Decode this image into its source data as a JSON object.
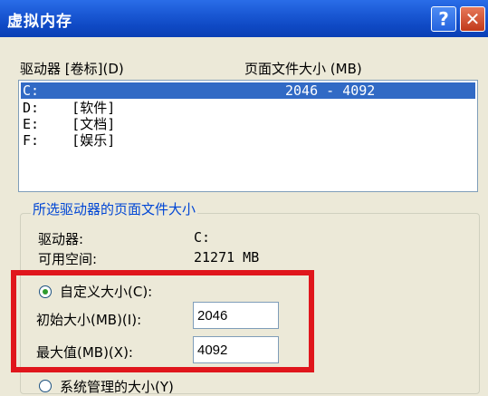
{
  "window": {
    "title": "虚拟内存",
    "help": "?",
    "close": "✕"
  },
  "list": {
    "drive_header": "驱动器 [卷标](D)",
    "size_header": "页面文件大小 (MB)",
    "rows": [
      {
        "drive": "C:",
        "size": "2046 - 4092",
        "selected": true
      },
      {
        "drive": "D:    [软件]",
        "size": ""
      },
      {
        "drive": "E:    [文档]",
        "size": ""
      },
      {
        "drive": "F:    [娱乐]",
        "size": ""
      }
    ]
  },
  "selected_drive_group": {
    "title": "所选驱动器的页面文件大小",
    "drive_label": "驱动器:",
    "drive_value": "C:",
    "free_label": "可用空间:",
    "free_value": "21271 MB"
  },
  "options": {
    "custom_size": {
      "label": "自定义大小(C):",
      "checked": true
    },
    "initial_size": {
      "label": "初始大小(MB)(I):",
      "value": "2046"
    },
    "max_size": {
      "label": "最大值(MB)(X):",
      "value": "4092"
    },
    "system_managed": {
      "label": "系统管理的大小(Y)",
      "checked": false
    }
  },
  "colors": {
    "accent": "#0a3fb5",
    "highlight": "#e0161c",
    "selection": "#316ac5"
  }
}
